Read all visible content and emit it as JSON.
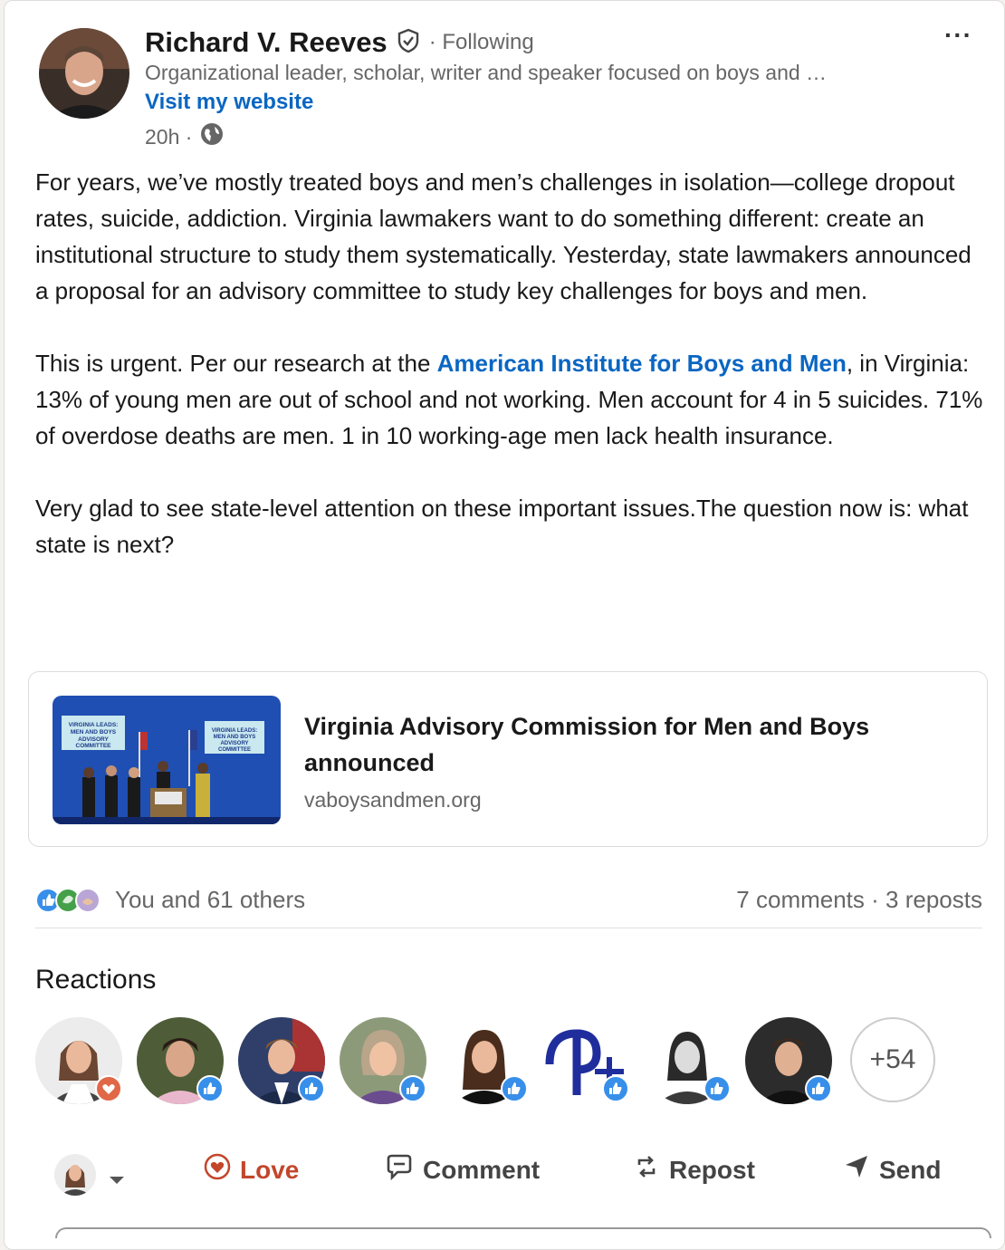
{
  "author": {
    "name": "Richard V. Reeves",
    "following": "· Following",
    "headline": "Organizational leader, scholar, writer and speaker focused on boys and …",
    "website": "Visit my website",
    "time": "20h ·",
    "menu": "···"
  },
  "post": {
    "p1": "For years, we’ve mostly treated boys and men’s challenges in isolation—college dropout rates, suicide, addiction. Virginia lawmakers want to do something different: create an institutional structure to study them systematically. Yesterday, state lawmakers announced a proposal for an advisory committee to study key challenges for boys and men.",
    "p2_before": "This is urgent. Per our research at the ",
    "p2_link": "American Institute for Boys and Men",
    "p2_after": ", in Virginia: 13% of young men are out of school and not working. Men account for 4 in 5 suicides. 71% of overdose deaths are men. 1 in 10 working-age men lack health insurance.",
    "p3": "Very glad to see state-level attention on these important issues.The question now is: what state is next?"
  },
  "article": {
    "title": "Virginia Advisory Commission for Men and Boys announced",
    "domain": "vaboysandmen.org",
    "image_banner_left": "VIRGINIA LEADS: MEN AND BOYS ADVISORY COMMITTEE",
    "image_banner_right": "VIRGINIA LEADS: MEN AND BOYS ADVISORY COMMITTEE"
  },
  "social": {
    "reactors_summary": "You and 61 others",
    "comments": "7 comments",
    "separator": "·",
    "reposts": "3 reposts"
  },
  "reactions": {
    "title": "Reactions",
    "more_count": "+54"
  },
  "actions": {
    "love": "Love",
    "comment": "Comment",
    "repost": "Repost",
    "send": "Send"
  },
  "colors": {
    "link": "#0a66c2",
    "love": "#c3462b",
    "like_badge": "#378fe9"
  }
}
